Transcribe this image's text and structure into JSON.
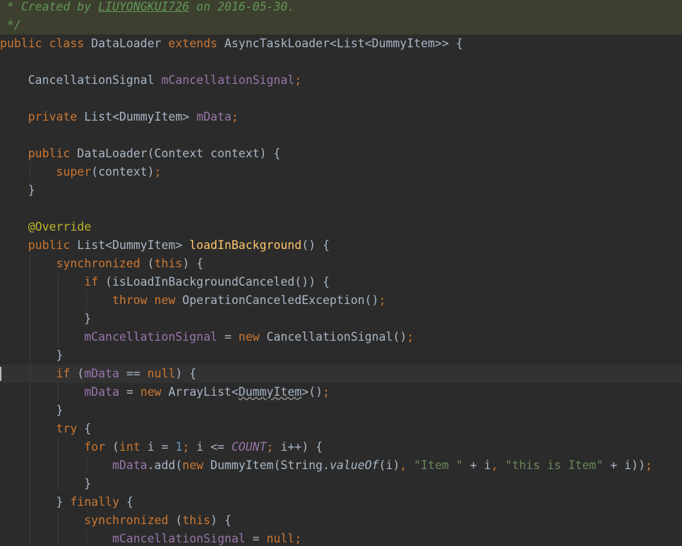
{
  "editor": {
    "colors": {
      "background": "#2b2b2b",
      "keyword": "#cc7832",
      "field": "#9876aa",
      "method": "#ffc66d",
      "string": "#6a8759",
      "comment": "#629755",
      "number": "#6897bb",
      "annotation": "#bbb529"
    },
    "lines": [
      {
        "tokens": [
          {
            "t": " * ",
            "c": "doc"
          },
          {
            "t": "Created by ",
            "c": "doc"
          },
          {
            "t": "LIUYONGKUI726",
            "c": "docu"
          },
          {
            "t": " on 2016-05-30.",
            "c": "doc"
          }
        ],
        "cls": "comment-block"
      },
      {
        "tokens": [
          {
            "t": " */",
            "c": "doc"
          }
        ],
        "cls": "comment-block"
      },
      {
        "tokens": [
          {
            "t": "public class ",
            "c": "kw"
          },
          {
            "t": "DataLoader ",
            "c": "plain"
          },
          {
            "t": "extends ",
            "c": "kw"
          },
          {
            "t": "AsyncTaskLoader<List<DummyItem>> {",
            "c": "plain"
          }
        ]
      },
      {
        "tokens": []
      },
      {
        "tokens": [
          {
            "t": "    CancellationSignal ",
            "c": "plain"
          },
          {
            "t": "mCancellationSignal",
            "c": "field"
          },
          {
            "t": ";",
            "c": "kw"
          }
        ]
      },
      {
        "tokens": []
      },
      {
        "tokens": [
          {
            "t": "    private ",
            "c": "kw"
          },
          {
            "t": "List<DummyItem> ",
            "c": "plain"
          },
          {
            "t": "mData",
            "c": "field"
          },
          {
            "t": ";",
            "c": "kw"
          }
        ]
      },
      {
        "tokens": []
      },
      {
        "tokens": [
          {
            "t": "    public ",
            "c": "kw"
          },
          {
            "t": "DataLoader(Context context) {",
            "c": "plain"
          }
        ]
      },
      {
        "tokens": [
          {
            "t": "        super",
            "c": "kw"
          },
          {
            "t": "(context)",
            "c": "plain"
          },
          {
            "t": ";",
            "c": "kw"
          }
        ]
      },
      {
        "tokens": [
          {
            "t": "    }",
            "c": "plain"
          }
        ]
      },
      {
        "tokens": []
      },
      {
        "tokens": [
          {
            "t": "    @Override",
            "c": "anno"
          }
        ]
      },
      {
        "tokens": [
          {
            "t": "    public ",
            "c": "kw"
          },
          {
            "t": "List<DummyItem> ",
            "c": "plain"
          },
          {
            "t": "loadInBackground",
            "c": "method"
          },
          {
            "t": "() {",
            "c": "plain"
          }
        ]
      },
      {
        "tokens": [
          {
            "t": "        synchronized ",
            "c": "kw"
          },
          {
            "t": "(",
            "c": "plain"
          },
          {
            "t": "this",
            "c": "kw"
          },
          {
            "t": ") {",
            "c": "plain"
          }
        ]
      },
      {
        "tokens": [
          {
            "t": "            if ",
            "c": "kw"
          },
          {
            "t": "(isLoadInBackgroundCanceled()) {",
            "c": "plain"
          }
        ]
      },
      {
        "tokens": [
          {
            "t": "                throw new ",
            "c": "kw"
          },
          {
            "t": "OperationCanceledException()",
            "c": "plain"
          },
          {
            "t": ";",
            "c": "kw"
          }
        ]
      },
      {
        "tokens": [
          {
            "t": "            }",
            "c": "plain"
          }
        ]
      },
      {
        "tokens": [
          {
            "t": "            mCancellationSignal ",
            "c": "field"
          },
          {
            "t": "= ",
            "c": "plain"
          },
          {
            "t": "new ",
            "c": "kw"
          },
          {
            "t": "CancellationSignal()",
            "c": "plain"
          },
          {
            "t": ";",
            "c": "kw"
          }
        ]
      },
      {
        "tokens": [
          {
            "t": "        }",
            "c": "plain"
          }
        ]
      },
      {
        "tokens": [
          {
            "t": "        if ",
            "c": "kw"
          },
          {
            "t": "(",
            "c": "plain"
          },
          {
            "t": "mData ",
            "c": "field"
          },
          {
            "t": "== ",
            "c": "plain"
          },
          {
            "t": "null",
            "c": "kw"
          },
          {
            "t": ") {",
            "c": "plain"
          }
        ],
        "cls": "current"
      },
      {
        "tokens": [
          {
            "t": "            mData ",
            "c": "field"
          },
          {
            "t": "= ",
            "c": "plain"
          },
          {
            "t": "new ",
            "c": "kw"
          },
          {
            "t": "ArrayList<",
            "c": "plain"
          },
          {
            "t": "DummyItem",
            "c": "warn"
          },
          {
            "t": ">()",
            "c": "plain"
          },
          {
            "t": ";",
            "c": "kw"
          }
        ]
      },
      {
        "tokens": [
          {
            "t": "        }",
            "c": "plain"
          }
        ]
      },
      {
        "tokens": [
          {
            "t": "        try ",
            "c": "kw"
          },
          {
            "t": "{",
            "c": "plain"
          }
        ]
      },
      {
        "tokens": [
          {
            "t": "            for ",
            "c": "kw"
          },
          {
            "t": "(",
            "c": "plain"
          },
          {
            "t": "int ",
            "c": "kw"
          },
          {
            "t": "i = ",
            "c": "plain"
          },
          {
            "t": "1",
            "c": "num"
          },
          {
            "t": "; ",
            "c": "kw"
          },
          {
            "t": "i <= ",
            "c": "plain"
          },
          {
            "t": "COUNT",
            "c": "const"
          },
          {
            "t": "; ",
            "c": "kw"
          },
          {
            "t": "i++) {",
            "c": "plain"
          }
        ]
      },
      {
        "tokens": [
          {
            "t": "                mData",
            "c": "field"
          },
          {
            "t": ".add(",
            "c": "plain"
          },
          {
            "t": "new ",
            "c": "kw"
          },
          {
            "t": "DummyItem(String.",
            "c": "plain"
          },
          {
            "t": "valueOf",
            "c": "ital"
          },
          {
            "t": "(i)",
            "c": "plain"
          },
          {
            "t": ", ",
            "c": "kw"
          },
          {
            "t": "\"Item \" ",
            "c": "str"
          },
          {
            "t": "+ i",
            "c": "plain"
          },
          {
            "t": ", ",
            "c": "kw"
          },
          {
            "t": "\"this is Item\" ",
            "c": "str"
          },
          {
            "t": "+ i))",
            "c": "plain"
          },
          {
            "t": ";",
            "c": "kw"
          }
        ]
      },
      {
        "tokens": [
          {
            "t": "            }",
            "c": "plain"
          }
        ]
      },
      {
        "tokens": [
          {
            "t": "        } ",
            "c": "plain"
          },
          {
            "t": "finally ",
            "c": "kw"
          },
          {
            "t": "{",
            "c": "plain"
          }
        ]
      },
      {
        "tokens": [
          {
            "t": "            synchronized ",
            "c": "kw"
          },
          {
            "t": "(",
            "c": "plain"
          },
          {
            "t": "this",
            "c": "kw"
          },
          {
            "t": ") {",
            "c": "plain"
          }
        ]
      },
      {
        "tokens": [
          {
            "t": "                mCancellationSignal ",
            "c": "field"
          },
          {
            "t": "= ",
            "c": "plain"
          },
          {
            "t": "null",
            "c": "kw"
          },
          {
            "t": ";",
            "c": "kw"
          }
        ]
      }
    ]
  }
}
